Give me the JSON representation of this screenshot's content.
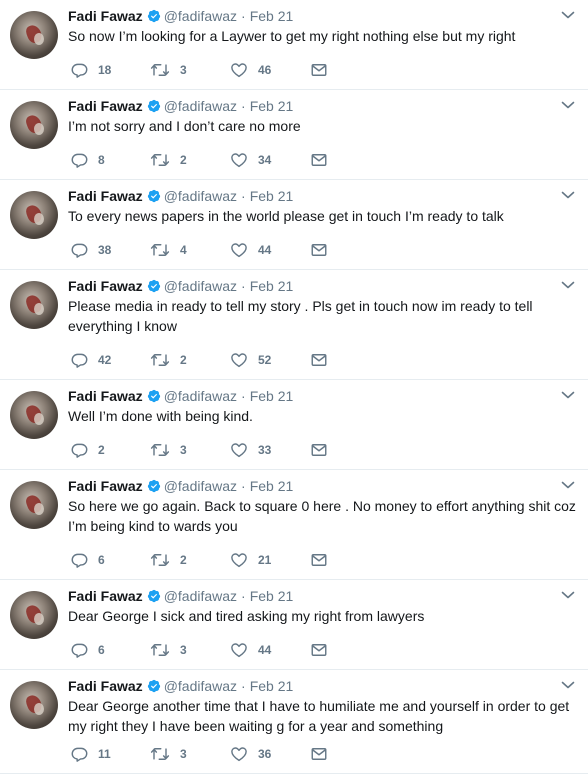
{
  "author": {
    "name": "Fadi Fawaz",
    "handle": "@fadifawaz",
    "separator": "·",
    "date": "Feb 21"
  },
  "icons": {
    "verified": "verified-badge-icon",
    "caret": "chevron-down-icon",
    "reply": "reply-icon",
    "retweet": "retweet-icon",
    "like": "heart-icon",
    "message": "envelope-icon"
  },
  "colors": {
    "verified": "#1da1f2",
    "text": "#14171a",
    "muted": "#657786",
    "divider": "#e6ecf0"
  },
  "tweets": [
    {
      "text": "So now I’m looking for a Laywer to get my right nothing else but my right",
      "replies": "18",
      "retweets": "3",
      "likes": "46"
    },
    {
      "text": "I’m not sorry and I don’t care no more",
      "replies": "8",
      "retweets": "2",
      "likes": "34"
    },
    {
      "text": "To every news papers in the world please get in touch I’m ready to talk",
      "replies": "38",
      "retweets": "4",
      "likes": "44"
    },
    {
      "text": "Please media in ready to tell my story . Pls get in touch now im ready to tell everything I know",
      "replies": "42",
      "retweets": "2",
      "likes": "52"
    },
    {
      "text": "Well I’m done with being kind.",
      "replies": "2",
      "retweets": "3",
      "likes": "33"
    },
    {
      "text": "So here we go again. Back to square 0 here . No money to effort anything shit coz I’m being kind to wards you",
      "replies": "6",
      "retweets": "2",
      "likes": "21"
    },
    {
      "text": "Dear George I sick and tired asking my right from lawyers",
      "replies": "6",
      "retweets": "3",
      "likes": "44"
    },
    {
      "text": "Dear George another time that I have to humiliate me and yourself in order to get my right they I have been waiting g for a year and something",
      "replies": "11",
      "retweets": "3",
      "likes": "36"
    }
  ]
}
